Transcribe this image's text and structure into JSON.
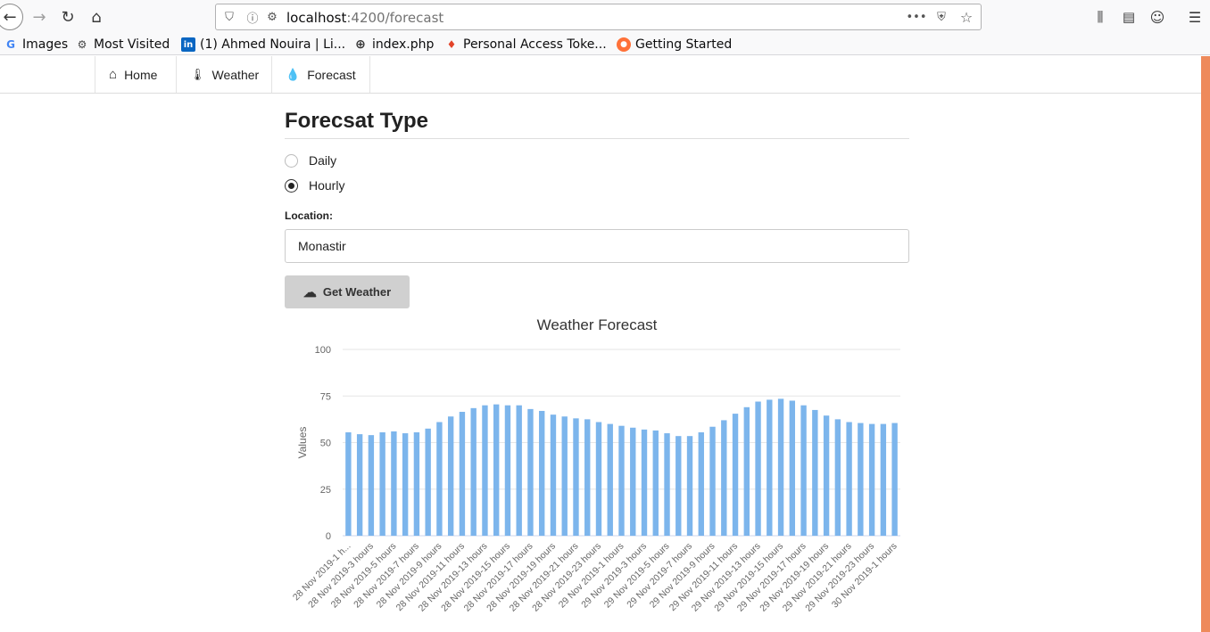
{
  "browser": {
    "url_host": "localhost",
    "url_path": ":4200/forecast",
    "bookmarks": [
      {
        "label": "Images",
        "icon": "google-icon"
      },
      {
        "label": "Most Visited",
        "icon": "gear-icon"
      },
      {
        "label": "(1) Ahmed Nouira | Li...",
        "icon": "linkedin-icon"
      },
      {
        "label": "index.php",
        "icon": "globe-icon"
      },
      {
        "label": "Personal Access Toke...",
        "icon": "gitlab-icon"
      },
      {
        "label": "Getting Started",
        "icon": "firefox-icon"
      }
    ]
  },
  "nav": {
    "items": [
      {
        "label": "Home",
        "icon": "home-icon"
      },
      {
        "label": "Weather",
        "icon": "thermometer-icon"
      },
      {
        "label": "Forecast",
        "icon": "droplet-icon"
      }
    ]
  },
  "form": {
    "title": "Forecsat Type",
    "radio_daily": "Daily",
    "radio_hourly": "Hourly",
    "selected": "Hourly",
    "location_label": "Location:",
    "location_value": "Monastir",
    "button_label": "Get Weather"
  },
  "chart_data": {
    "type": "bar",
    "title": "Weather Forecast",
    "xlabel": "",
    "ylabel": "Values",
    "ylim": [
      0,
      100
    ],
    "yticks": [
      0,
      25,
      50,
      75,
      100
    ],
    "grid": true,
    "bar_color": "#7cb5ec",
    "categories": [
      "28 Nov 2019-1 h...",
      "",
      "28 Nov 2019-3 hours",
      "",
      "28 Nov 2019-5 hours",
      "",
      "28 Nov 2019-7 hours",
      "",
      "28 Nov 2019-9 hours",
      "",
      "28 Nov 2019-11 hours",
      "",
      "28 Nov 2019-13 hours",
      "",
      "28 Nov 2019-15 hours",
      "",
      "28 Nov 2019-17 hours",
      "",
      "28 Nov 2019-19 hours",
      "",
      "28 Nov 2019-21 hours",
      "",
      "28 Nov 2019-23 hours",
      "",
      "29 Nov 2019-1 hours",
      "",
      "29 Nov 2019-3 hours",
      "",
      "29 Nov 2019-5 hours",
      "",
      "29 Nov 2019-7 hours",
      "",
      "29 Nov 2019-9 hours",
      "",
      "29 Nov 2019-11 hours",
      "",
      "29 Nov 2019-13 hours",
      "",
      "29 Nov 2019-15 hours",
      "",
      "29 Nov 2019-17 hours",
      "",
      "29 Nov 2019-19 hours",
      "",
      "29 Nov 2019-21 hours",
      "",
      "29 Nov 2019-23 hours",
      "",
      "30 Nov 2019-1 hours"
    ],
    "values": [
      55.5,
      54.5,
      54,
      55.5,
      56,
      55,
      55.5,
      57.5,
      61,
      64,
      66.5,
      68.5,
      70,
      70.5,
      70,
      70,
      68,
      67,
      65,
      64,
      63,
      62.5,
      61,
      60,
      59,
      58,
      57,
      56.5,
      55,
      53.5,
      53.5,
      55.5,
      58.5,
      62,
      65.5,
      69,
      72,
      73,
      73.5,
      72.5,
      70,
      67.5,
      64.5,
      62.5,
      61,
      60.5,
      60,
      60,
      60.5
    ]
  }
}
